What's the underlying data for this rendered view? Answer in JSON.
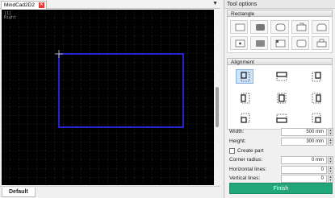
{
  "document": {
    "tab_title": "MindCad2D2",
    "view_label_line1": "[1]",
    "view_label_line2": "Right",
    "bottom_tab": "Default"
  },
  "panel": {
    "title": "Tool options",
    "shape_section": "Rectangle",
    "shapes": [
      [
        "rect-simple-icon",
        "rect-rounded-icon",
        "rect-rounded2-icon",
        "rect-tab-icon",
        "rect-bevel-icon",
        "rect-dots-icon"
      ],
      [
        "rect-slot-icon",
        "rect-fillet-icon",
        "rect-corner-icon",
        "rect-rounded-small-icon",
        "rect-tab2-icon"
      ]
    ],
    "alignment_section": "Alignment",
    "fields": {
      "width_label": "Width:",
      "width_value": "500 mm",
      "height_label": "Height:",
      "height_value": "300 mm",
      "create_part_label": "Create part",
      "corner_label": "Corner radius:",
      "corner_value": "0 mm",
      "hlines_label": "Horizontal lines:",
      "hlines_value": "0",
      "vlines_label": "Vertical lines:",
      "vlines_value": "0"
    },
    "finish_label": "Finish"
  },
  "colors": {
    "accent_green": "#21a67a",
    "rect_blue": "#2f2bff",
    "canvas": "#000000"
  }
}
